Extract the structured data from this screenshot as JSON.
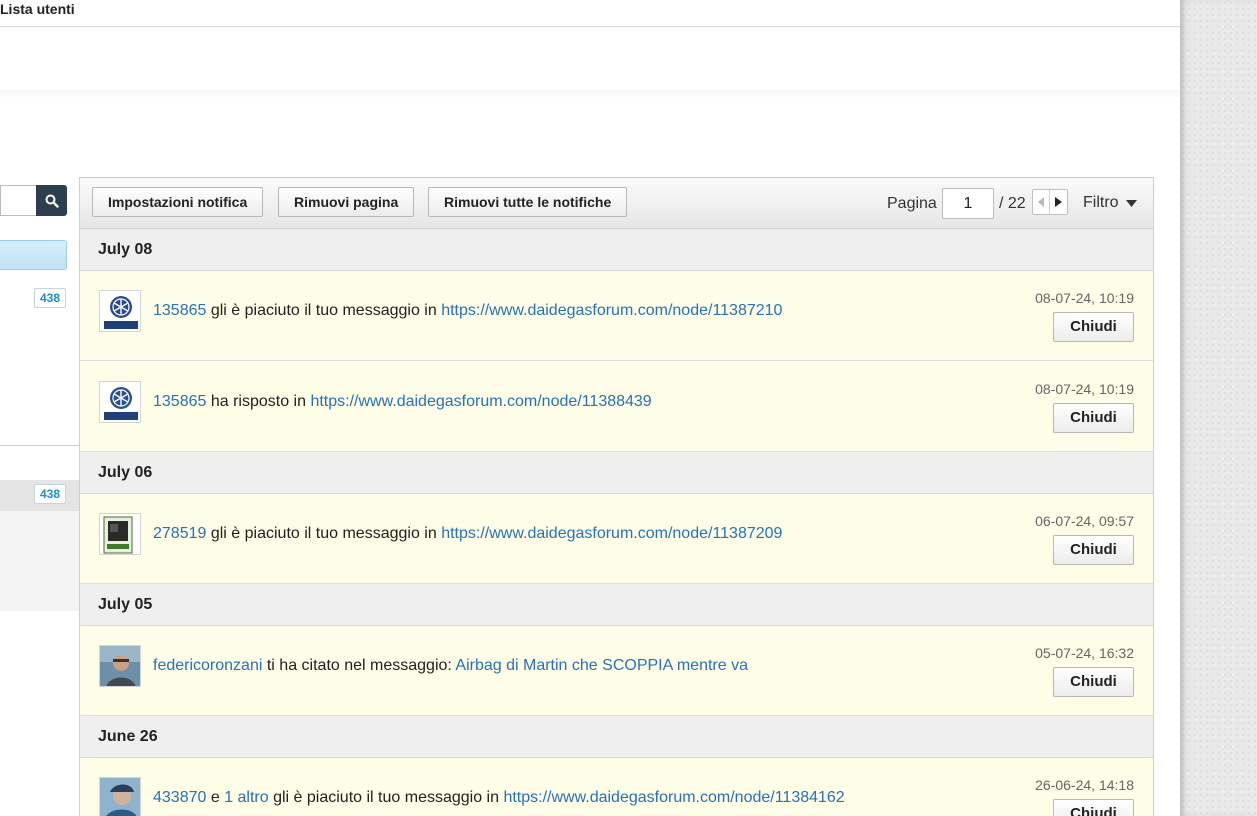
{
  "topnav": {
    "user_list": "Lista utenti"
  },
  "sidebar": {
    "badge_1": "438",
    "badge_2": "438"
  },
  "toolbar": {
    "settings_label": "Impostazioni notifica",
    "remove_page_label": "Rimuovi pagina",
    "remove_all_label": "Rimuovi tutte le notifiche"
  },
  "pager": {
    "label": "Pagina",
    "current": "1",
    "total": "/ 22"
  },
  "filter": {
    "label": "Filtro"
  },
  "groups": [
    {
      "date": "July 08",
      "items": [
        {
          "user": "135865",
          "text": " gli è piaciuto il tuo messaggio in ",
          "link": "https://www.daidegasforum.com/node/11387210",
          "time": "08-07-24, 10:19",
          "close": "Chiudi",
          "avatar": "yamaha-logo"
        },
        {
          "user": "135865",
          "text": " ha risposto in ",
          "link": "https://www.daidegasforum.com/node/11388439",
          "time": "08-07-24, 10:19",
          "close": "Chiudi",
          "avatar": "yamaha-logo"
        }
      ]
    },
    {
      "date": "July 06",
      "items": [
        {
          "user": "278519",
          "text": " gli è piaciuto il tuo messaggio in ",
          "link": "https://www.daidegasforum.com/node/11387209",
          "time": "06-07-24, 09:57",
          "close": "Chiudi",
          "avatar": "engine-photo"
        }
      ]
    },
    {
      "date": "July 05",
      "items": [
        {
          "user": "federicoronzani",
          "text": " ti ha citato nel messaggio: ",
          "link": "Airbag di Martin che SCOPPIA mentre va",
          "time": "05-07-24, 16:32",
          "close": "Chiudi",
          "avatar": "user-photo"
        }
      ]
    },
    {
      "date": "June 26",
      "items": [
        {
          "user": "433870",
          "connector": " e ",
          "others": "1 altro",
          "text": " gli è piaciuto il tuo messaggio in ",
          "link": "https://www.daidegasforum.com/node/11384162",
          "time": "26-06-24, 14:18",
          "close": "Chiudi",
          "avatar": "user-photo"
        }
      ]
    }
  ]
}
